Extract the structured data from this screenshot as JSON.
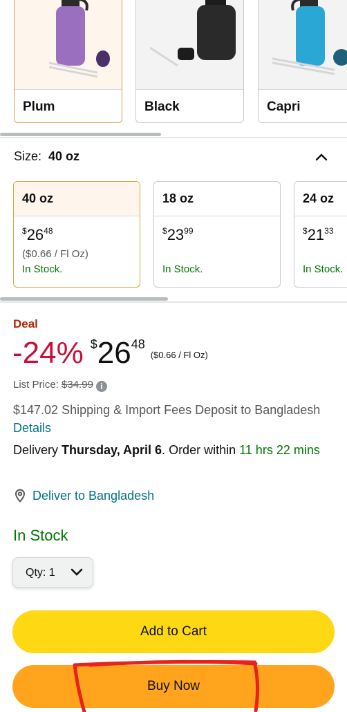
{
  "colors": {
    "options": [
      {
        "label": "Plum",
        "selected": true,
        "bottle_color": "#9b6fbf"
      },
      {
        "label": "Black",
        "selected": false,
        "bottle_color": "#2a2a2a"
      },
      {
        "label": "Capri",
        "selected": false,
        "bottle_color": "#2aa7d4"
      }
    ]
  },
  "size": {
    "label": "Size:",
    "selected": "40 oz",
    "options": [
      {
        "name": "40 oz",
        "symbol": "$",
        "whole": "26",
        "cents": "48",
        "unit_price": "($0.66 / Fl Oz)",
        "stock": "In Stock.",
        "selected": true
      },
      {
        "name": "18 oz",
        "symbol": "$",
        "whole": "23",
        "cents": "99",
        "unit_price": "",
        "stock": "In Stock.",
        "selected": false
      },
      {
        "name": "24 oz",
        "symbol": "$",
        "whole": "21",
        "cents": "33",
        "unit_price": "",
        "stock": "In Stock.",
        "selected": false
      }
    ]
  },
  "price": {
    "deal_label": "Deal",
    "discount": "-24%",
    "symbol": "$",
    "whole": "26",
    "cents": "48",
    "per_unit": "($0.66 / Fl Oz)",
    "list_price_label": "List Price:",
    "list_price": "$34.99"
  },
  "shipping": {
    "text": "$147.02 Shipping & Import Fees Deposit to Bangladesh",
    "details_link": "Details"
  },
  "delivery": {
    "prefix": "Delivery",
    "date": "Thursday, April 6",
    "order_within": ". Order within",
    "countdown": "11 hrs 22 mins"
  },
  "deliver_to": "Deliver to Bangladesh",
  "stock_status": "In Stock",
  "quantity": {
    "label": "Qty:",
    "value": "1"
  },
  "buttons": {
    "add_to_cart": "Add to Cart",
    "buy_now": "Buy Now"
  },
  "theme": {
    "add_to_cart": "#ffd814",
    "buy_now": "#ffa41c",
    "deal": "#cc0c39",
    "in_stock": "#007600",
    "link": "#007185",
    "annotation": "#e8221e"
  }
}
